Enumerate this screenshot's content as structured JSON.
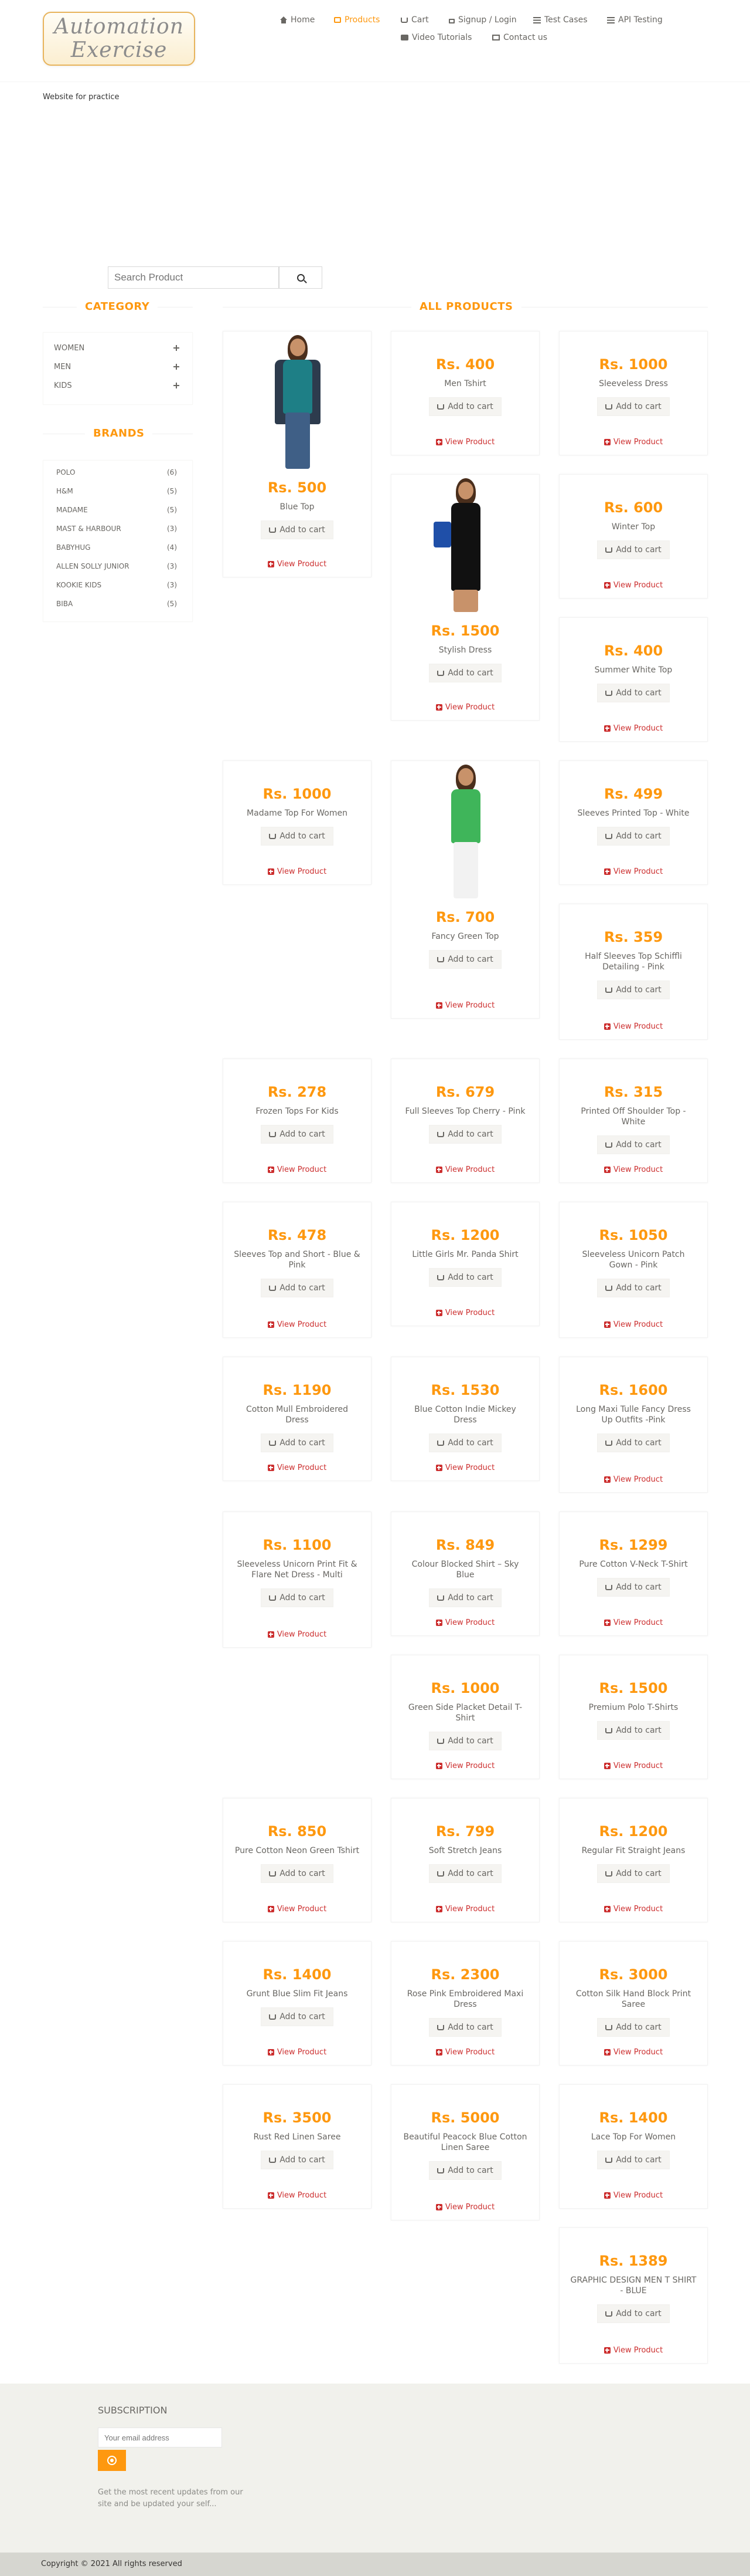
{
  "header": {
    "logo_line1": "Automation",
    "logo_line2": "Exercise",
    "tagline": "Website for practice",
    "nav": [
      {
        "label": "Home",
        "icon": "home-icon"
      },
      {
        "label": "Products",
        "icon": "products-icon",
        "active": true
      },
      {
        "label": "Cart",
        "icon": "cart-icon"
      },
      {
        "label": "Signup / Login",
        "icon": "lock-icon"
      },
      {
        "label": "Test Cases",
        "icon": "list-icon"
      },
      {
        "label": "API Testing",
        "icon": "list-icon"
      },
      {
        "label": "Video Tutorials",
        "icon": "video-icon"
      },
      {
        "label": "Contact us",
        "icon": "envelope-icon"
      }
    ]
  },
  "search": {
    "placeholder": "Search Product",
    "button_icon": "search-icon"
  },
  "sidebar": {
    "category_title": "Category",
    "categories": [
      "Women",
      "Men",
      "Kids"
    ],
    "brands_title": "Brands",
    "brands": [
      {
        "name": "Polo",
        "count": "(6)"
      },
      {
        "name": "H&M",
        "count": "(5)"
      },
      {
        "name": "Madame",
        "count": "(5)"
      },
      {
        "name": "Mast & Harbour",
        "count": "(3)"
      },
      {
        "name": "Babyhug",
        "count": "(4)"
      },
      {
        "name": "Allen Solly Junior",
        "count": "(3)"
      },
      {
        "name": "Kookie Kids",
        "count": "(3)"
      },
      {
        "name": "Biba",
        "count": "(5)"
      }
    ]
  },
  "products_section": {
    "title": "All Products",
    "add_to_cart_label": "Add to cart",
    "view_product_label": "View Product",
    "items": [
      {
        "price": "Rs. 500",
        "name": "Blue Top"
      },
      {
        "price": "Rs. 400",
        "name": "Men Tshirt"
      },
      {
        "price": "Rs. 1000",
        "name": "Sleeveless Dress"
      },
      {
        "price": "Rs. 1500",
        "name": "Stylish Dress"
      },
      {
        "price": "Rs. 600",
        "name": "Winter Top"
      },
      {
        "price": "Rs. 400",
        "name": "Summer White Top"
      },
      {
        "price": "Rs. 1000",
        "name": "Madame Top For Women"
      },
      {
        "price": "Rs. 700",
        "name": "Fancy Green Top"
      },
      {
        "price": "Rs. 499",
        "name": "Sleeves Printed Top - White"
      },
      {
        "price": "Rs. 359",
        "name": "Half Sleeves Top Schiffli Detailing - Pink"
      },
      {
        "price": "Rs. 278",
        "name": "Frozen Tops For Kids"
      },
      {
        "price": "Rs. 679",
        "name": "Full Sleeves Top Cherry - Pink"
      },
      {
        "price": "Rs. 315",
        "name": "Printed Off Shoulder Top - White"
      },
      {
        "price": "Rs. 478",
        "name": "Sleeves Top and Short - Blue & Pink"
      },
      {
        "price": "Rs. 1200",
        "name": "Little Girls Mr. Panda Shirt"
      },
      {
        "price": "Rs. 1050",
        "name": "Sleeveless Unicorn Patch Gown - Pink"
      },
      {
        "price": "Rs. 1190",
        "name": "Cotton Mull Embroidered Dress"
      },
      {
        "price": "Rs. 1530",
        "name": "Blue Cotton Indie Mickey Dress"
      },
      {
        "price": "Rs. 1600",
        "name": "Long Maxi Tulle Fancy Dress Up Outfits -Pink"
      },
      {
        "price": "Rs. 1100",
        "name": "Sleeveless Unicorn Print Fit & Flare Net Dress - Multi"
      },
      {
        "price": "Rs. 849",
        "name": "Colour Blocked Shirt – Sky Blue"
      },
      {
        "price": "Rs. 1299",
        "name": "Pure Cotton V-Neck T-Shirt"
      },
      {
        "price": "Rs. 1000",
        "name": "Green Side Placket Detail T-Shirt"
      },
      {
        "price": "Rs. 1500",
        "name": "Premium Polo T-Shirts"
      },
      {
        "price": "Rs. 850",
        "name": "Pure Cotton Neon Green Tshirt"
      },
      {
        "price": "Rs. 799",
        "name": "Soft Stretch Jeans"
      },
      {
        "price": "Rs. 1200",
        "name": "Regular Fit Straight Jeans"
      },
      {
        "price": "Rs. 1400",
        "name": "Grunt Blue Slim Fit Jeans"
      },
      {
        "price": "Rs. 2300",
        "name": "Rose Pink Embroidered Maxi Dress"
      },
      {
        "price": "Rs. 3000",
        "name": "Cotton Silk Hand Block Print Saree"
      },
      {
        "price": "Rs. 3500",
        "name": "Rust Red Linen Saree"
      },
      {
        "price": "Rs. 5000",
        "name": "Beautiful Peacock Blue Cotton Linen Saree"
      },
      {
        "price": "Rs. 1400",
        "name": "Lace Top For Women"
      },
      {
        "price": "Rs. 1389",
        "name": "GRAPHIC DESIGN MEN T SHIRT - BLUE"
      }
    ]
  },
  "footer": {
    "subscription_title": "Subscription",
    "email_placeholder": "Your email address",
    "subscribe_icon": "arrow-circle-icon",
    "subscription_text": "Get the most recent updates from our site and be updated your self...",
    "copyright": "Copyright © 2021 All rights reserved"
  },
  "colors": {
    "accent": "#fe980f",
    "text": "#696763",
    "view_product": "#cc2f2f",
    "footer_bg": "#f1f1ec",
    "copyright_bg": "#d6d6d0"
  }
}
